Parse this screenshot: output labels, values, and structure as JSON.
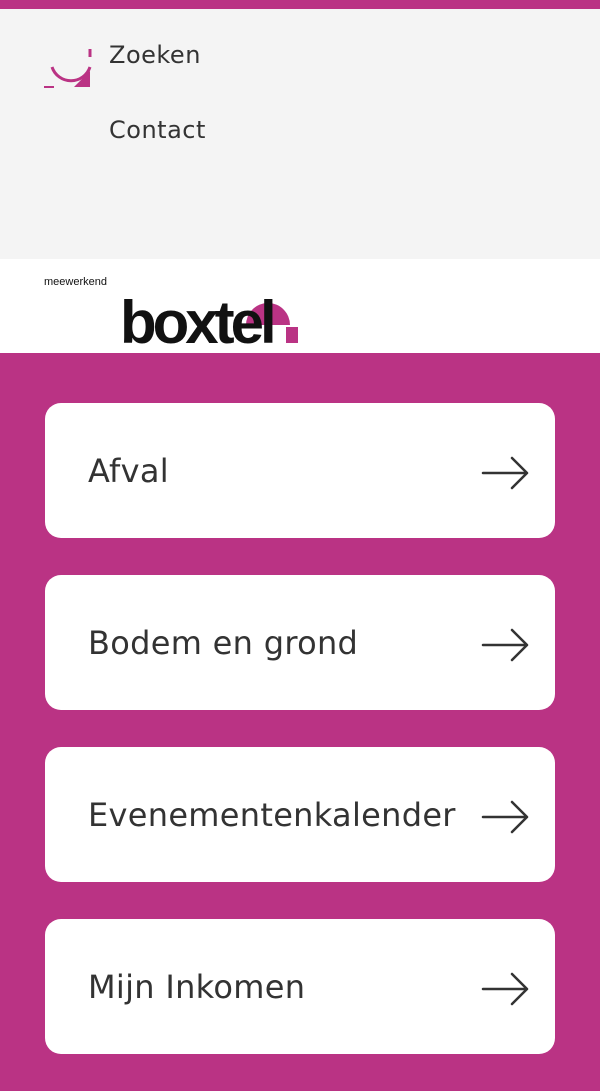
{
  "top_nav": {
    "search_label": "Zoeken",
    "contact_label": "Contact"
  },
  "logo": {
    "tagline": "meewerkend",
    "wordmark": "boxtel"
  },
  "colors": {
    "brand": "#ba3384",
    "nav_bg": "#f4f4f4",
    "text": "#333333"
  },
  "cards": [
    {
      "label": "Afval",
      "icon": "arrow-right-icon"
    },
    {
      "label": "Bodem en grond",
      "icon": "arrow-right-icon"
    },
    {
      "label": "Evenementenkalender",
      "icon": "arrow-right-icon"
    },
    {
      "label": "Mijn Inkomen",
      "icon": "arrow-right-icon"
    }
  ]
}
